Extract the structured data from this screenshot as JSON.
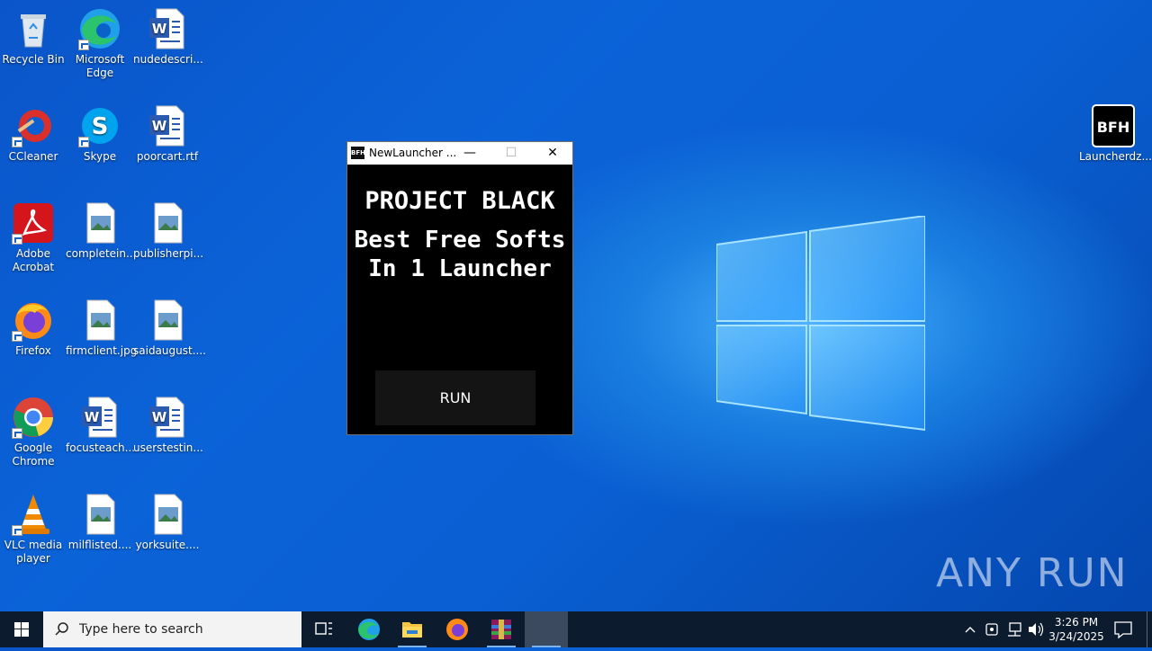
{
  "desktop": {
    "icons": [
      {
        "label": "Recycle Bin",
        "icon": "recycle-bin-icon"
      },
      {
        "label": "Microsoft Edge",
        "icon": "edge-icon"
      },
      {
        "label": "nudedescri...",
        "icon": "word-doc-icon"
      },
      {
        "label": "CCleaner",
        "icon": "ccleaner-icon"
      },
      {
        "label": "Skype",
        "icon": "skype-icon"
      },
      {
        "label": "poorcart.rtf",
        "icon": "word-doc-icon"
      },
      {
        "label": "Adobe Acrobat",
        "icon": "acrobat-icon"
      },
      {
        "label": "completein...",
        "icon": "image-file-icon"
      },
      {
        "label": "publisherpi...",
        "icon": "image-file-icon"
      },
      {
        "label": "Firefox",
        "icon": "firefox-icon"
      },
      {
        "label": "firmclient.jpg",
        "icon": "image-file-icon"
      },
      {
        "label": "saidaugust....",
        "icon": "image-file-icon"
      },
      {
        "label": "Google Chrome",
        "icon": "chrome-icon"
      },
      {
        "label": "focusteach...",
        "icon": "word-doc-icon"
      },
      {
        "label": "userstestin...",
        "icon": "word-doc-icon"
      },
      {
        "label": "VLC media player",
        "icon": "vlc-icon"
      },
      {
        "label": "milflisted....",
        "icon": "image-file-icon"
      },
      {
        "label": "yorksuite....",
        "icon": "image-file-icon"
      },
      {
        "label": "Launcherdz...",
        "icon": "bfh-icon",
        "badge": "BFH"
      }
    ]
  },
  "window": {
    "title": "NewLauncher ...",
    "app_icon_text": "BFH",
    "minimize": "—",
    "maximize": "☐",
    "close": "✕",
    "heading": "PROJECT BLACK",
    "subheading_line1": "Best Free Softs",
    "subheading_line2": "In 1 Launcher",
    "run_label": "RUN"
  },
  "taskbar": {
    "search_placeholder": "Type here to search",
    "clock_time": "3:26 PM",
    "clock_date": "3/24/2025",
    "pinned": [
      "task-view-icon",
      "edge-icon",
      "file-explorer-icon",
      "firefox-icon",
      "winrar-icon",
      "active-app"
    ]
  },
  "watermark": "ANY RUN",
  "colors": {
    "desktop": "#0a5fd2",
    "taskbar": "#0d1b2e",
    "window_bg": "#000000"
  }
}
